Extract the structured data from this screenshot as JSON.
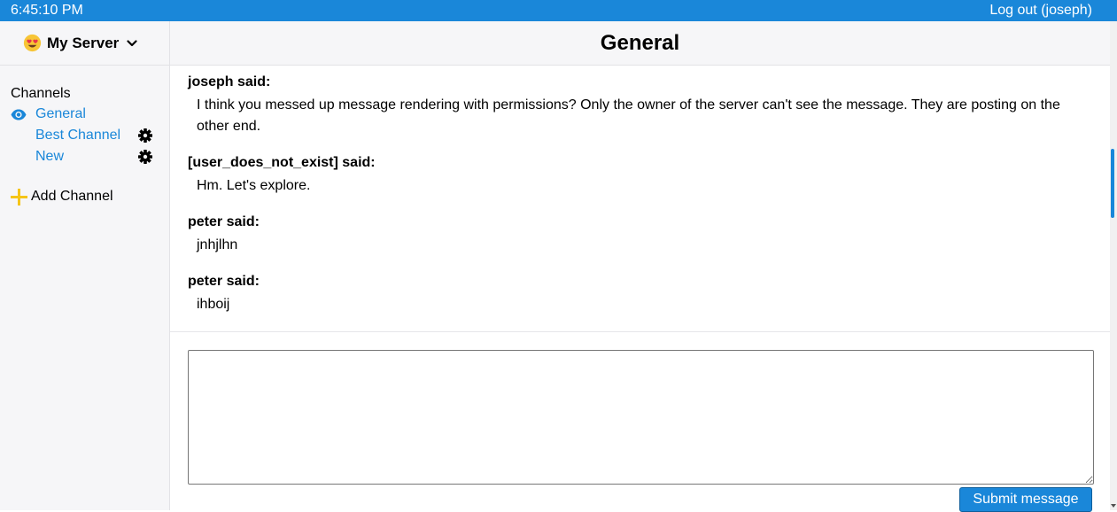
{
  "topbar": {
    "clock": "6:45:10 PM",
    "logout_label": "Log out (joseph)"
  },
  "sidebar": {
    "server_name": "My Server",
    "server_icon": "heart-eyes-emoji",
    "channels_heading": "Channels",
    "channels": [
      {
        "label": "General",
        "active": true,
        "icon": "eye-icon"
      },
      {
        "label": "Best Channel",
        "settings_icon": "gear-icon"
      },
      {
        "label": "New",
        "settings_icon": "gear-icon"
      }
    ],
    "add_channel_label": "Add Channel"
  },
  "main": {
    "title": "General",
    "messages": [
      {
        "author": "joseph said:",
        "text": "I think you messed up message rendering with permissions? Only the owner of the server can't see the message. They are posting on the other end."
      },
      {
        "author": "[user_does_not_exist] said:",
        "text": "Hm. Let's explore."
      },
      {
        "author": "peter said:",
        "text": "jnhjlhn"
      },
      {
        "author": "peter said:",
        "text": "ihboij"
      }
    ],
    "composer": {
      "value": "",
      "placeholder": ""
    },
    "submit_label": "Submit message"
  },
  "colors": {
    "accent": "#1a87d9",
    "sidebar_bg": "#f6f6f8",
    "plus_icon": "#f5c518"
  }
}
